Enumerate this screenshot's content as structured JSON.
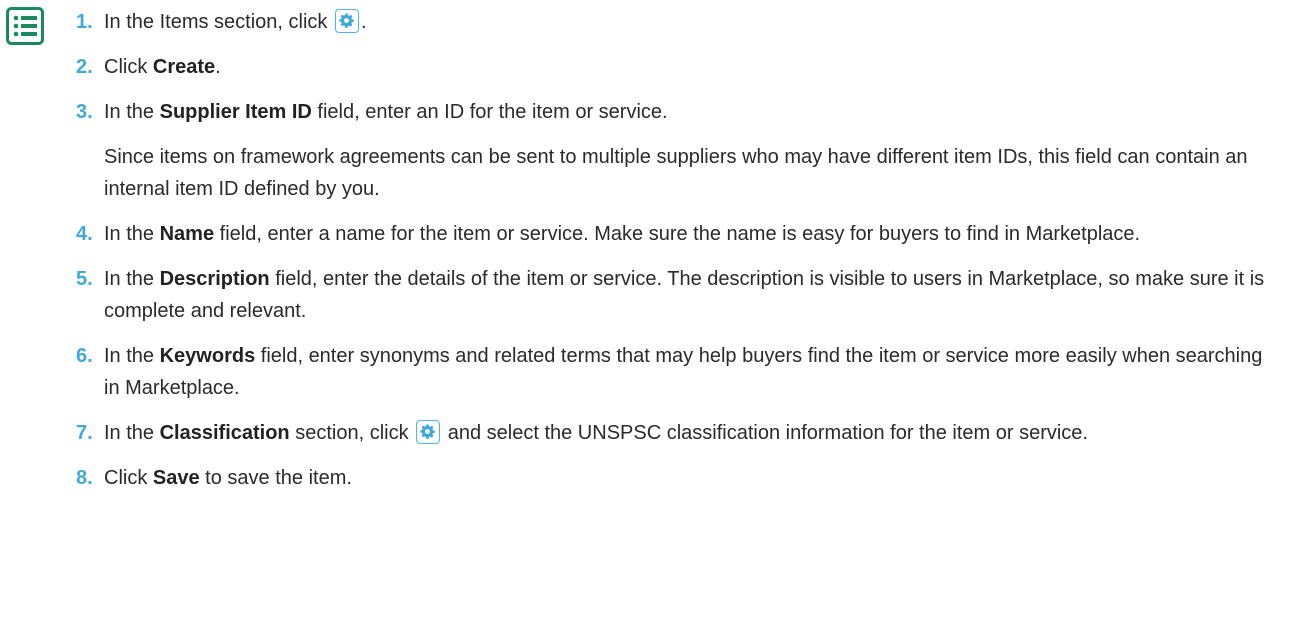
{
  "icon": "list-icon",
  "gear_icon": "gear-icon",
  "colors": {
    "accent": "#3fa9dc",
    "text": "#2a2a2a",
    "icon_green": "#1a8a5c"
  },
  "steps": [
    {
      "num": "1.",
      "before": "In the Items section, click",
      "after": "."
    },
    {
      "num": "2.",
      "before": "Click ",
      "bold": "Create",
      "after": "."
    },
    {
      "num": "3.",
      "before": "In the ",
      "bold": "Supplier Item ID",
      "after": " field, enter an ID for the item or service.",
      "note": "Since items on framework agreements can be sent to multiple suppliers who may have different item IDs, this field can contain an internal item ID defined by you."
    },
    {
      "num": "4.",
      "before": "In the ",
      "bold": "Name",
      "after": " field, enter a name for the item or service. Make sure the name is easy for buyers to find in Marketplace."
    },
    {
      "num": "5.",
      "before": "In the ",
      "bold": "Description",
      "after": " field, enter the details of the item or service. The description is visible to users in Marketplace, so make sure it is complete and relevant."
    },
    {
      "num": "6.",
      "before": "In the ",
      "bold": "Keywords",
      "after": " field, enter synonyms and related terms that may help buyers find the item or service more easily when searching in Marketplace."
    },
    {
      "num": "7.",
      "before": "In the ",
      "bold": "Classification",
      "middle": " section, click",
      "after": " and select the UNSPSC classification information for the item or service."
    },
    {
      "num": "8.",
      "before": "Click ",
      "bold": "Save",
      "after": " to save the item."
    }
  ]
}
